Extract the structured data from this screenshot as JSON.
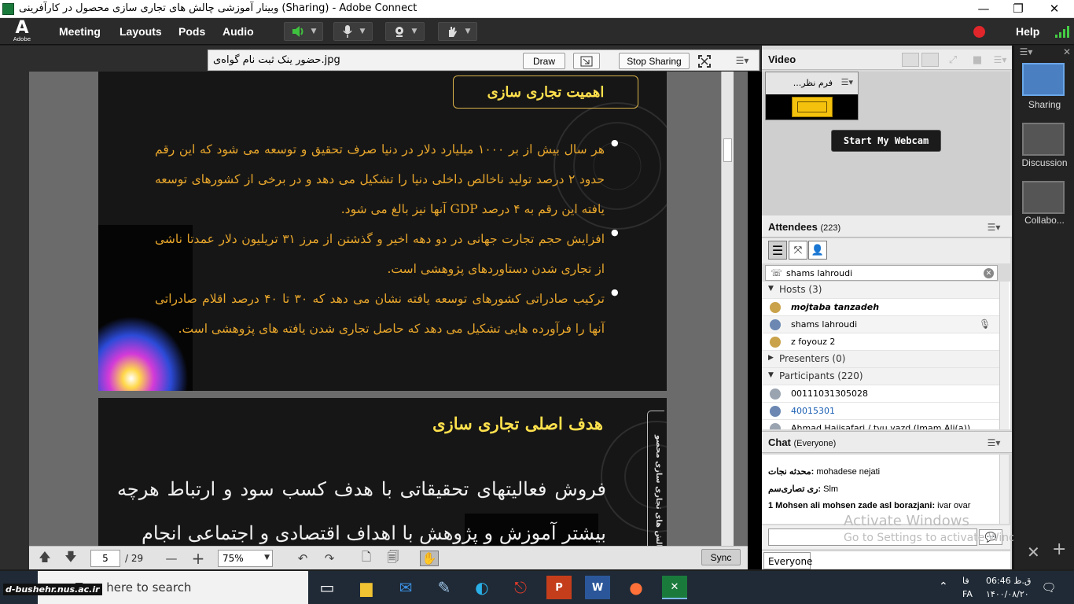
{
  "window": {
    "title": "وبینار آموزشی چالش های تجاری سازی محصول در کارآفرینی (Sharing) - Adobe Connect",
    "minimize": "—",
    "maximize": "❐",
    "close": "✕"
  },
  "menubar": {
    "logo": "A",
    "logo_sub": "Adobe",
    "items": [
      "Meeting",
      "Layouts",
      "Pods",
      "Audio"
    ],
    "help": "Help"
  },
  "share": {
    "filename": "حضور ینک ثبت نام گواه‌ی.jpg",
    "draw_label": "Draw",
    "stop_sharing_label": "Stop Sharing",
    "page_current": "5",
    "page_total": "/ 29",
    "zoom": "75%",
    "sync_label": "Sync"
  },
  "slide1": {
    "heading": "اهمیت تجاری سازی",
    "bullets": [
      "هر سال بیش از بر ۱۰۰۰ میلیارد دلار در دنیا صرف تحقیق و توسعه می شود که این رقم حدود ۲ درصد تولید ناخالص داخلی دنیا را تشکیل می دهد و در برخی از کشورهای توسعه یافته این رقم به ۴ درصد GDP آنها نیز بالغ می شود.",
      "افزایش حجم تجارت جهانی در دو دهه اخیر و گذشتن از مرز ۳۱ تریلیون دلار عمدتا ناشی از تجاری شدن دستاوردهای پژوهشی است.",
      "ترکیب صادراتی کشورهای توسعه یافته نشان می دهد که ۳۰ تا ۴۰ درصد اقلام صادراتی آنها را فرآورده هایی تشکیل می دهد که حاصل تجاری شدن یافته های پژوهشی است."
    ]
  },
  "slide2": {
    "heading": "هدف اصلی تجاری سازی",
    "body": "فروش فعالیتهای تحقیقاتی با هدف کسب سود و ارتباط هرچه بیشتر آموزش و پژوهش با اهداف اقتصادی و اجتماعی انجام",
    "side_label": "چالش های تجاری سازی محصو"
  },
  "video": {
    "title": "Video",
    "feed_name": "فرم نظر...",
    "start_webcam_label": "Start My Webcam"
  },
  "attendees": {
    "title": "Attendees",
    "count": "(223)",
    "search_value": "shams lahroudi",
    "hosts_label": "Hosts (3)",
    "hosts": [
      "mojtaba tanzadeh",
      "shams lahroudi",
      "z foyouz 2"
    ],
    "presenters_label": "Presenters (0)",
    "participants_label": "Participants (220)",
    "participants": [
      "00111031305028",
      "40015301",
      "Ahmad Hajisafari / tvu yazd (Imam Ali(a))"
    ]
  },
  "chat": {
    "title": "Chat",
    "scope": "(Everyone)",
    "messages": [
      {
        "sender": "محدثه نجات:",
        "text": " mohadese nejati"
      },
      {
        "sender": "ری تصاری‌سم:",
        "text": " Slm"
      },
      {
        "sender": "1 Mohsen ali mohsen zade asl borazjani:",
        "text": " ivar ovar"
      }
    ],
    "watermark1": "Activate Windows",
    "watermark2": "Go to Settings to activate Windows.",
    "recipient": "Everyone"
  },
  "layouts": {
    "items": [
      "Sharing",
      "Discussion",
      "Collabo..."
    ]
  },
  "taskbar": {
    "search_placeholder": "Type here to search",
    "site_watermark": "d-bushehr.nus.ac.ir",
    "clock_time": "06:46 ق.ظ",
    "clock_date": "۱۴۰۰/۰۸/۲۰",
    "lang1": "فا",
    "lang2": "FA"
  },
  "colors": {
    "menubar": "#2b2b2b",
    "slide_text": "#e8a62b",
    "slide_heading": "#ffe14d",
    "record": "#e0262b",
    "link_blue": "#1a5fb4"
  }
}
